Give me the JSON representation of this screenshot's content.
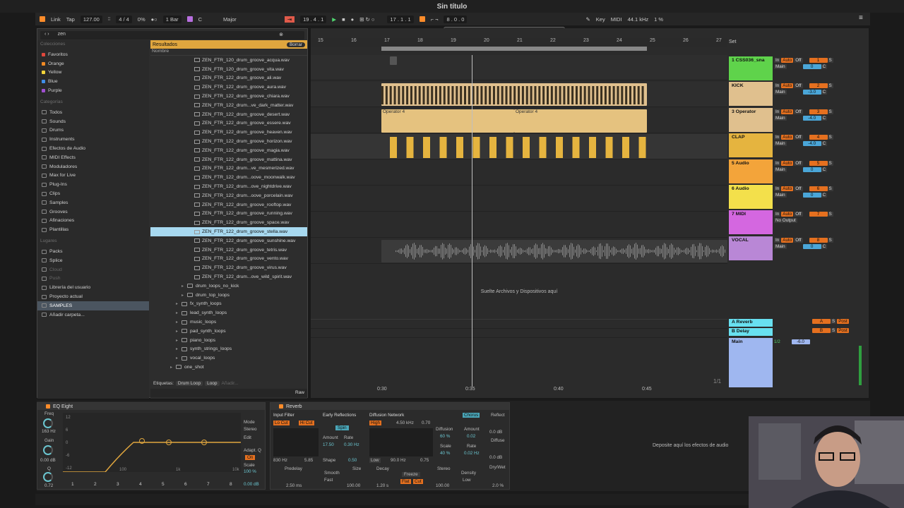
{
  "window_title": "Sin título",
  "transport": {
    "link": "Link",
    "tap": "Tap",
    "tempo": "127.00",
    "time_sig": "4 / 4",
    "percent": "0%",
    "quantize": "1 Bar",
    "key_root": "C",
    "scale": "Major",
    "position": "19 .  4 .  1",
    "loop_start": "17 .  1 .  1",
    "loop_len": "8 .  0 .  0",
    "key_label": "Key",
    "midi_label": "MIDI",
    "sample_rate": "44.1 kHz",
    "cpu": "1 %"
  },
  "browser": {
    "search_value": "zen",
    "collections_header": "Colecciones",
    "collections": [
      {
        "label": "Favoritos",
        "color": "#e0473c"
      },
      {
        "label": "Orange",
        "color": "#f08a24"
      },
      {
        "label": "Yellow",
        "color": "#f2d43a"
      },
      {
        "label": "Blue",
        "color": "#3f8ee8"
      },
      {
        "label": "Purple",
        "color": "#a04fd1"
      }
    ],
    "categories_header": "Categorías",
    "categories": [
      "Todos",
      "Sounds",
      "Drums",
      "Instruments",
      "Efectos de Audio",
      "MIDI Effects",
      "Moduladores",
      "Max for Live",
      "Plug-Ins",
      "Clips",
      "Samples",
      "Grooves",
      "Afinaciones",
      "Plantillas"
    ],
    "places_header": "Lugares",
    "places": [
      "Packs",
      "Splice",
      "Cloud",
      "Push",
      "Librería del usuario",
      "Proyecto actual",
      "SAMPLES",
      "Añadir carpeta..."
    ],
    "results_label": "Resultados",
    "clear_label": "Borrar",
    "name_header": "Nombre",
    "files": [
      "ZEN_FTR_120_drum_groove_acqua.wav",
      "ZEN_FTR_120_drum_groove_vita.wav",
      "ZEN_FTR_122_drum_groove_ali.wav",
      "ZEN_FTR_122_drum_groove_aura.wav",
      "ZEN_FTR_122_drum_groove_chiara.wav",
      "ZEN_FTR_122_drum...ve_dark_matter.wav",
      "ZEN_FTR_122_drum_groove_desert.wav",
      "ZEN_FTR_122_drum_groove_essere.wav",
      "ZEN_FTR_122_drum_groove_heaven.wav",
      "ZEN_FTR_122_drum_groove_horizon.wav",
      "ZEN_FTR_122_drum_groove_magia.wav",
      "ZEN_FTR_122_drum_groove_mattina.wav",
      "ZEN_FTR_122_drum...ve_mesmerized.wav",
      "ZEN_FTR_122_drum...oove_moonwalk.wav",
      "ZEN_FTR_122_drum...ove_nightdrive.wav",
      "ZEN_FTR_122_drum...oove_porcelain.wav",
      "ZEN_FTR_122_drum_groove_rooftop.wav",
      "ZEN_FTR_122_drum_groove_running.wav",
      "ZEN_FTR_122_drum_groove_space.wav",
      "ZEN_FTR_122_drum_groove_stella.wav",
      "ZEN_FTR_122_drum_groove_sunshine.wav",
      "ZEN_FTR_122_drum_groove_tetris.wav",
      "ZEN_FTR_122_drum_groove_vento.wav",
      "ZEN_FTR_122_drum_groove_virus.wav",
      "ZEN_FTR_122_drum...ove_wild_spirit.wav"
    ],
    "folders": [
      "drum_loops_no_kick",
      "drum_top_loops",
      "fx_synth_loops",
      "lead_synth_loops",
      "music_loops",
      "pad_synth_loops",
      "piano_loops",
      "synth_strings_loops",
      "vocal_loops",
      "one_shot"
    ],
    "tags_label": "Etiquetas:",
    "tags": [
      "Drum Loop",
      "Loop",
      "Añadir..."
    ],
    "raw_label": "Raw"
  },
  "arrangement": {
    "ruler": [
      "15",
      "16",
      "17",
      "18",
      "19",
      "20",
      "21",
      "22",
      "23",
      "24",
      "25",
      "26",
      "27"
    ],
    "operator_clip": "Operator 4",
    "drop_text": "Suelte Archivos y Dispositivos aquí",
    "time_marks": [
      "0:30",
      "0:35",
      "0:40",
      "0:45"
    ],
    "page": "1/1"
  },
  "mixer": {
    "set_label": "Set",
    "tracks": [
      {
        "name": "1 CSS036_sna",
        "color": "#5fd34b",
        "num": "1",
        "routing": "Main",
        "vol": "0"
      },
      {
        "name": "KICK",
        "color": "#e0c08e",
        "num": "2",
        "routing": "Main",
        "vol": "-3.0"
      },
      {
        "name": "3 Operator",
        "color": "#e0c08e",
        "num": "3",
        "routing": "Main",
        "vol": "-4.0"
      },
      {
        "name": "CLAP",
        "color": "#e5b43f",
        "num": "4",
        "routing": "Main",
        "vol": "-4.0"
      },
      {
        "name": "5 Audio",
        "color": "#f3a43a",
        "num": "5",
        "routing": "Main",
        "vol": "0"
      },
      {
        "name": "6 Audio",
        "color": "#f3e04b",
        "num": "6",
        "routing": "Main",
        "vol": "0"
      },
      {
        "name": "7 MIDI",
        "color": "#d467e0",
        "num": "7",
        "routing": "No Output",
        "vol": ""
      },
      {
        "name": "VOCAL",
        "color": "#b987d6",
        "num": "8",
        "routing": "Main",
        "vol": "0"
      }
    ],
    "returns": [
      {
        "name": "A Reverb",
        "letter": "A",
        "color": "#68e0f0"
      },
      {
        "name": "B Delay",
        "letter": "B",
        "color": "#68e0f0"
      }
    ],
    "main_label": "Main",
    "main_vol": "-6.0",
    "in_label": "In",
    "auto_label": "Auto",
    "off_label": "Off",
    "s_label": "S",
    "c_label": "C",
    "post_label": "Post",
    "half": "1/2"
  },
  "devices": {
    "eq_title": "EQ Eight",
    "eq_freq": "163 Hz",
    "eq_gain": "0.00 dB",
    "eq_q": "0.72",
    "eq_mode": "Stereo",
    "eq_edit": "Edit",
    "eq_adapt": "Adapt. Q",
    "eq_on": "On",
    "eq_scale_label": "Scale",
    "eq_scale": "100 %",
    "eq_gain2": "0.00 dB",
    "eq_axis": [
      "12",
      "6",
      "0",
      "-6",
      "-12"
    ],
    "eq_freq_axis": [
      "100",
      "1k",
      "10k"
    ],
    "eq_bands": [
      "1",
      "2",
      "3",
      "4",
      "5",
      "6",
      "7",
      "8"
    ],
    "reverb_title": "Reverb",
    "input_filter": "Input Filter",
    "lo_cut": "Lo Cut",
    "hi_cut": "Hi Cut",
    "if_freq": "830 Hz",
    "if_width": "5.85",
    "early_ref": "Early Reflections",
    "spin": "Spin",
    "amount_lbl": "Amount",
    "rate_lbl": "Rate",
    "er_amount": "17.50",
    "er_rate": "0.30 Hz",
    "shape_lbl": "Shape",
    "er_shape": "0.50",
    "diffusion_net": "Diffusion Network",
    "high": "High",
    "dn_freq": "4.50 kHz",
    "dn_val": "0.70",
    "low": "Low",
    "dn_low_freq": "90.0 Hz",
    "dn_low_val": "0.75",
    "diffusion_lbl": "Diffusion",
    "diffusion": "60 %",
    "scale_lbl": "Scale",
    "scale": "40 %",
    "chorus": "Chorus",
    "ch_amount": "0.02",
    "ch_rate": "0.02 Hz",
    "reflect_lbl": "Reflect",
    "reflect": "0.0 dB",
    "diffuse_lbl": "Diffuse",
    "diffuse": "0.0 dB",
    "drywet_lbl": "Dry/Wet",
    "drywet": "2.0 %",
    "predelay_lbl": "Predelay",
    "predelay": "2.50 ms",
    "smooth_lbl": "Smooth",
    "smooth": "Fast",
    "size_lbl": "Size",
    "size": "100.00",
    "decay_lbl": "Decay",
    "decay": "1.20 s",
    "freeze_lbl": "Freeze",
    "flat": "Flat",
    "cut": "Cut",
    "stereo_lbl": "Stereo",
    "stereo": "100.00",
    "density_lbl": "Density",
    "density": "Low",
    "drop_fx": "Deposite aquí los efectos de audio"
  }
}
